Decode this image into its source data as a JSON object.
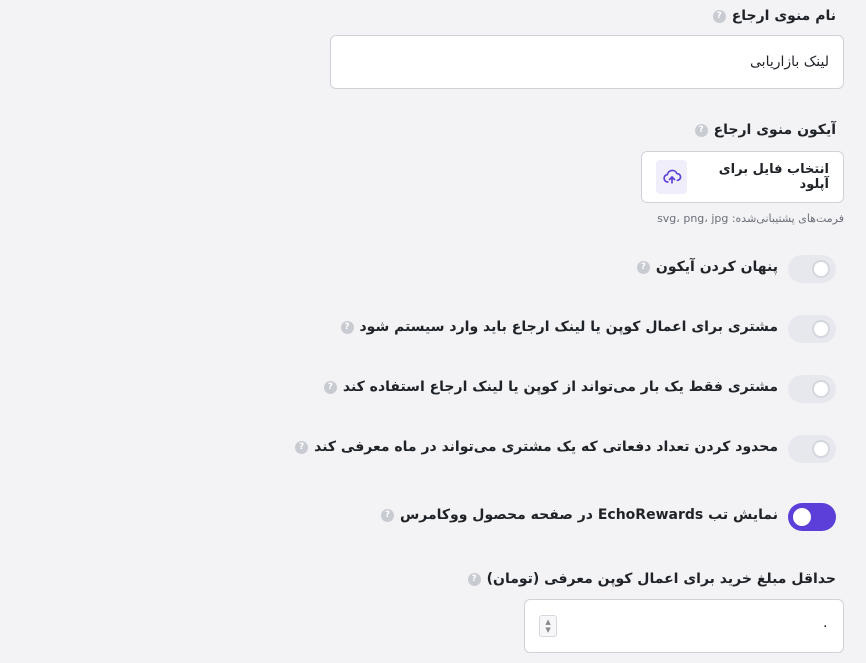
{
  "referral_menu": {
    "name_label": "نام منوی ارجاع",
    "name_value": "لینک بازاریابی",
    "icon_label": "آیکون منوی ارجاع",
    "upload_label": "انتخاب فایل برای آپلود",
    "formats_hint": "فرمت‌های پشتیبانی‌شده: svg، png، jpg"
  },
  "toggles": [
    {
      "label": "پنهان کردن آیکون",
      "on": false
    },
    {
      "label": "مشتری برای اعمال کوپن یا لینک ارجاع باید وارد سیستم شود",
      "on": false
    },
    {
      "label": "مشتری فقط یک بار می‌تواند از کوپن یا لینک ارجاع استفاده کند",
      "on": false
    },
    {
      "label": "محدود کردن تعداد دفعاتی که یک مشتری می‌تواند در ماه معرفی کند",
      "on": false
    },
    {
      "label": "نمایش تب EchoRewards در صفحه محصول ووکامرس",
      "on": true
    }
  ],
  "min_purchase": {
    "label": "حداقل مبلغ خرید برای اعمال کوپن معرفی (تومان)",
    "value": "۰"
  },
  "help_glyph": "?",
  "colors": {
    "accent": "#5b3fd8",
    "switch_off": "#e6e8ee"
  }
}
